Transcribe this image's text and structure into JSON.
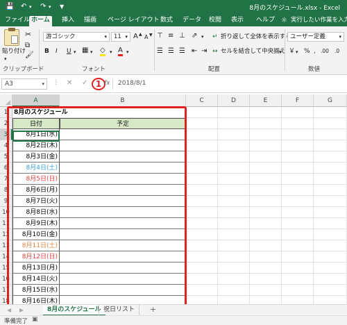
{
  "titlebar": {
    "save_icon": "save-icon",
    "undo_icon": "undo-icon",
    "redo_icon": "redo-icon",
    "title": "8月のスケジュール.xlsx  -  Excel"
  },
  "tabs": [
    "ファイル",
    "ホーム",
    "挿入",
    "描画",
    "ページ レイアウト",
    "数式",
    "データ",
    "校閲",
    "表示",
    "ヘルプ"
  ],
  "tell_me": "実行したい作業を入力し",
  "ribbon": {
    "paste_label": "貼り付け",
    "clipboard_group": "クリップボード",
    "font_name": "游ゴシック",
    "font_size": "11",
    "font_group": "フォント",
    "wrap_text": "折り返して全体を表示する",
    "merge_center": "セルを結合して中央揃え",
    "alignment_group": "配置",
    "number_format": "ユーザー定義",
    "number_group": "数値",
    "bold": "B",
    "italic": "I",
    "underline": "U",
    "grow_font": "A",
    "shrink_font": "A",
    "font_color_letter": "A",
    "currency": "￥",
    "percent": "%",
    "comma": ",",
    "decimal_inc": ".00",
    "decimal_dec": ".0"
  },
  "formula_bar": {
    "name_box": "A3",
    "fx": "fx",
    "value": "2018/8/1",
    "annotation": "1"
  },
  "columns": [
    "A",
    "B",
    "C",
    "D",
    "E",
    "F",
    "G"
  ],
  "rows": [
    {
      "num": "1",
      "a": "8月のスケジュール",
      "b": "",
      "color": "#000000"
    },
    {
      "num": "2",
      "a": "日付",
      "b": "予定",
      "color": "#000000"
    },
    {
      "num": "3",
      "a": "8月1日(水)",
      "b": "",
      "color": "#000000"
    },
    {
      "num": "4",
      "a": "8月2日(木)",
      "b": "",
      "color": "#000000"
    },
    {
      "num": "5",
      "a": "8月3日(金)",
      "b": "",
      "color": "#000000"
    },
    {
      "num": "6",
      "a": "8月4日(土)",
      "b": "",
      "color": "#3aa0d8"
    },
    {
      "num": "7",
      "a": "8月5日(日)",
      "b": "",
      "color": "#e03b3b"
    },
    {
      "num": "8",
      "a": "8月6日(月)",
      "b": "",
      "color": "#000000"
    },
    {
      "num": "9",
      "a": "8月7日(火)",
      "b": "",
      "color": "#000000"
    },
    {
      "num": "10",
      "a": "8月8日(水)",
      "b": "",
      "color": "#000000"
    },
    {
      "num": "11",
      "a": "8月9日(木)",
      "b": "",
      "color": "#000000"
    },
    {
      "num": "12",
      "a": "8月10日(金)",
      "b": "",
      "color": "#000000"
    },
    {
      "num": "13",
      "a": "8月11日(土)",
      "b": "",
      "color": "#e8803a"
    },
    {
      "num": "14",
      "a": "8月12日(日)",
      "b": "",
      "color": "#e03b3b"
    },
    {
      "num": "15",
      "a": "8月13日(月)",
      "b": "",
      "color": "#000000"
    },
    {
      "num": "16",
      "a": "8月14日(火)",
      "b": "",
      "color": "#000000"
    },
    {
      "num": "17",
      "a": "8月15日(水)",
      "b": "",
      "color": "#000000"
    },
    {
      "num": "18",
      "a": "8月16日(木)",
      "b": "",
      "color": "#000000"
    }
  ],
  "sheets": {
    "active": "8月のスケジュール",
    "other": "祝日リスト",
    "add": "+"
  },
  "status": "準備完了",
  "colors": {
    "excel_green": "#217346",
    "header_fill": "#d7e8c6",
    "highlight_border": "#e01f1f"
  }
}
